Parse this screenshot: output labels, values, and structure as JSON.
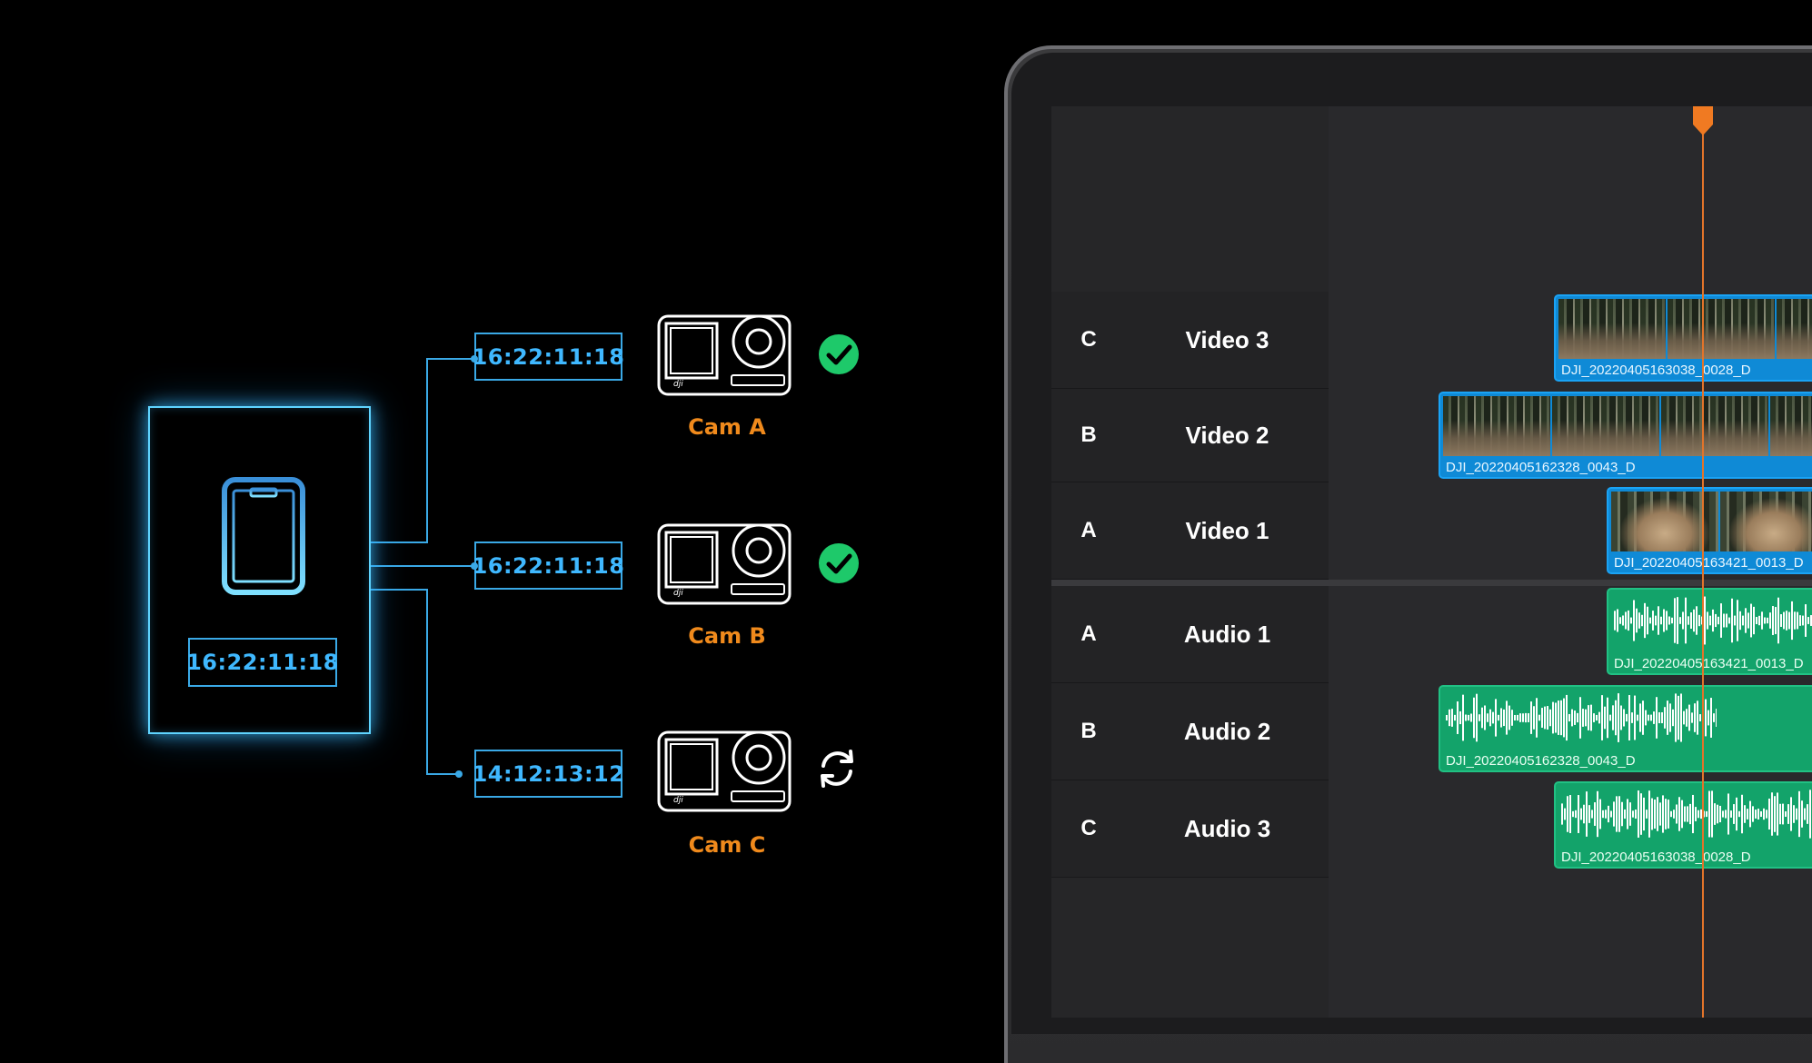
{
  "sync_diagram": {
    "master_timecode": "16:22:11:18",
    "cameras": [
      {
        "timecode": "16:22:11:18",
        "label": "Cam A",
        "status": "synced",
        "status_icon": "check-circle-icon"
      },
      {
        "timecode": "16:22:11:18",
        "label": "Cam B",
        "status": "synced",
        "status_icon": "check-circle-icon"
      },
      {
        "timecode": "14:12:13:12",
        "label": "Cam C",
        "status": "syncing",
        "status_icon": "refresh-icon"
      }
    ],
    "colors": {
      "wire": "#3aa9e6",
      "timecode_text": "#3fb8ff",
      "cam_label": "#f08a1c",
      "check": "#1ec96a"
    }
  },
  "timeline": {
    "playhead_color": "#e2742a",
    "video_tracks": [
      {
        "letter": "C",
        "name": "Video 3",
        "clip": "DJI_20220405163038_0028_D"
      },
      {
        "letter": "B",
        "name": "Video 2",
        "clip": "DJI_20220405162328_0043_D"
      },
      {
        "letter": "A",
        "name": "Video 1",
        "clip": "DJI_20220405163421_0013_D"
      }
    ],
    "audio_tracks": [
      {
        "letter": "A",
        "name": "Audio 1",
        "clip": "DJI_20220405163421_0013_D"
      },
      {
        "letter": "B",
        "name": "Audio 2",
        "clip": "DJI_20220405162328_0043_D"
      },
      {
        "letter": "C",
        "name": "Audio 3",
        "clip": "DJI_20220405163038_0028_D"
      }
    ],
    "colors": {
      "video_clip": "#0f8ad6",
      "audio_clip": "#13a36a"
    }
  }
}
